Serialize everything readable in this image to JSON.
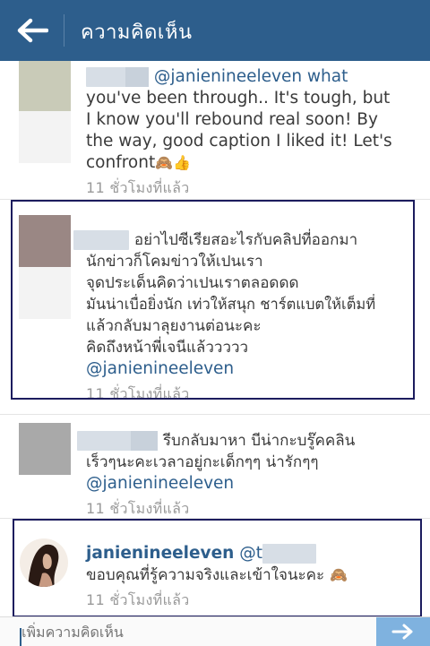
{
  "header": {
    "title": "ความคิดเห็น",
    "bg_color": "#2d5e8c"
  },
  "comments": [
    {
      "user_visible": "",
      "lines": [
        "@janienineeleven what",
        "you've been through.. It's tough, but",
        "I know you'll rebound real soon!   By",
        "the way, good caption I liked it! Let's",
        "confront"
      ],
      "emoji": "🙈👍",
      "mention": "@janienineeleven",
      "time": "11 ชั่วโมงที่แล้ว"
    },
    {
      "lines": [
        "อย่าไปซีเรียสอะไรกับคลิปที่ออกมา",
        "นักข่าวก็โคมข่าวให้เปนเรา",
        "จุดประเด็นคิดว่าเปนเราตลอดดด",
        "มันน่าเบื่อยิ่งนัก เท่วให้สนุก ชาร์ตแบตให้เต็มที่",
        "แล้วกลับมาลุยงานต่อนะคะ",
        "คิดถึงหน้าพี่เจนีแล้ววววว"
      ],
      "mention": "@janienineeleven",
      "time": "11 ชั่วโมงที่แล้ว"
    },
    {
      "lines": [
        "รีบกลับมาหา บีน่ากะบรู๊คคลิน",
        "เร็วๆนะคะเวลาอยู่กะเด็กๆๆ น่ารักๆๆ"
      ],
      "mention": "@janienineeleven",
      "time": "11 ชั่วโมงที่แล้ว"
    },
    {
      "username": "janienineeleven",
      "reply_prefix": "@t",
      "text": "ขอบคุณที่รู้ความจริงและเข้าใจนะคะ",
      "emoji": "🙈",
      "time": "11 ชั่วโมงที่แล้ว"
    }
  ],
  "input": {
    "placeholder": "เพิ่มความคิดเห็น"
  },
  "colors": {
    "accent": "#2d5e8c",
    "send": "#7fb2df",
    "highlight_border": "#1c1c5e"
  }
}
